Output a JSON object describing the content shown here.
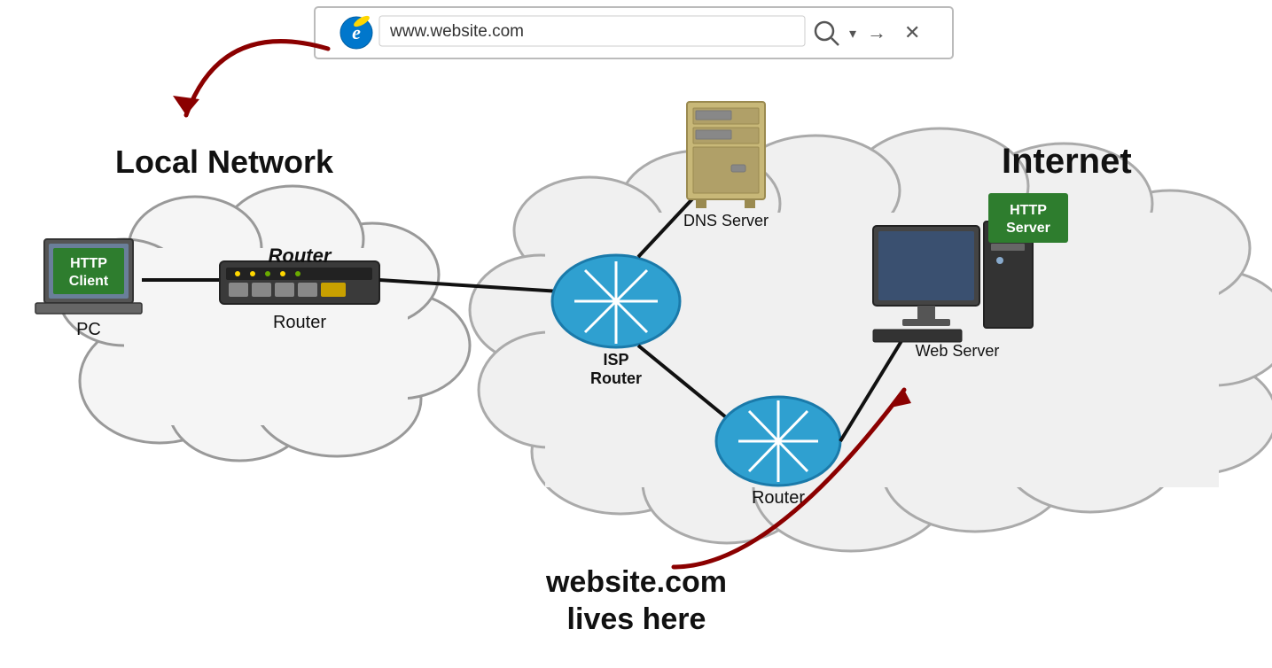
{
  "browser": {
    "url": "www.website.com",
    "search_icon": "🔍",
    "dropdown_icon": "▾",
    "forward_icon": "→",
    "close_icon": "✕"
  },
  "local_network": {
    "label": "Local Network",
    "pc_label": "PC",
    "router_label": "Router",
    "http_client_line1": "HTTP",
    "http_client_line2": "Client"
  },
  "internet": {
    "label": "Internet",
    "isp_router_label1": "ISP",
    "isp_router_label2": "Router",
    "dns_server_label": "DNS Server",
    "bottom_router_label": "Router",
    "web_server_label": "Web Server",
    "http_server_line1": "HTTP",
    "http_server_line2": "Server"
  },
  "tagline_line1": "website.com",
  "tagline_line2": "lives here"
}
